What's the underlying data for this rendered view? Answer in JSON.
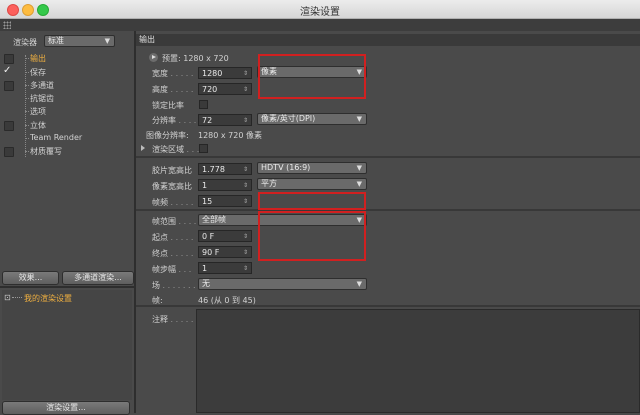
{
  "window": {
    "title": "渲染设置"
  },
  "left": {
    "renderer_label": "渲染器",
    "renderer_value": "标准",
    "tree": [
      {
        "label": "输出",
        "selected": true,
        "checked": false
      },
      {
        "label": "保存",
        "selected": false,
        "checked": true
      },
      {
        "label": "多通道",
        "selected": false,
        "checked": false
      },
      {
        "label": "抗锯齿",
        "selected": false,
        "checked": null
      },
      {
        "label": "选项",
        "selected": false,
        "checked": null
      },
      {
        "label": "立体",
        "selected": false,
        "checked": false
      },
      {
        "label": "Team Render",
        "selected": false,
        "checked": null
      },
      {
        "label": "材质覆写",
        "selected": false,
        "checked": false
      }
    ],
    "effects_button": "效果...",
    "multipass_button": "多通道渲染...",
    "render_settings_item": "我的渲染设置",
    "render_settings_button": "渲染设置..."
  },
  "panel": {
    "header": "输出",
    "preset_label": "预置: 1280 x 720",
    "width_label": "宽度",
    "width_value": "1280",
    "height_label": "高度",
    "height_value": "720",
    "unit_value": "像素",
    "lock_ratio_label": "锁定比率",
    "resolution_label": "分辨率",
    "resolution_value": "72",
    "resolution_unit": "像素/英寸(DPI)",
    "image_resolution_label": "图像分辨率:",
    "image_resolution_value": "1280 x 720 像素",
    "render_region_label": "渲染区域",
    "film_aspect_label": "胶片宽高比",
    "film_aspect_value": "1.778",
    "film_aspect_preset": "HDTV (16:9)",
    "pixel_aspect_label": "像素宽高比",
    "pixel_aspect_value": "1",
    "pixel_aspect_preset": "平方",
    "frame_rate_label": "帧频",
    "frame_rate_value": "15",
    "frame_range_label": "帧范围",
    "frame_range_value": "全部帧",
    "start_label": "起点",
    "start_value": "0 F",
    "end_label": "终点",
    "end_value": "90 F",
    "frame_step_label": "帧步幅",
    "frame_step_value": "1",
    "field_label": "场",
    "field_value": "无",
    "frames_label": "帧:",
    "frames_value": "46 (从 0 到 45)",
    "notes_label": "注释"
  },
  "colors": {
    "highlight": "#d12020",
    "selected": "#f0b040"
  }
}
